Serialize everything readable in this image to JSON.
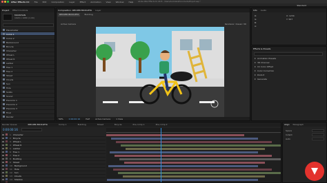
{
  "window": {
    "app_title": "After Effects CC",
    "title": "Adobe After Effects CC 2015 - /Users/Animated/Documents/Project.aep *",
    "close_color": "#ff5f57",
    "minimize_color": "#febc2e",
    "zoom_color": "#28c840"
  },
  "menu": [
    "After Effects CC",
    "File",
    "Edit",
    "Composition",
    "Layer",
    "Effect",
    "Animation",
    "View",
    "Window",
    "Help"
  ],
  "toolbar": {
    "workspace": "Standard"
  },
  "project_panel": {
    "tab": "Project",
    "tab2": "Effect Controls",
    "comp_name": "MOUNTAIN",
    "comp_info": "1920 x 1080 (1.00)",
    "items": [
      "Placeholder",
      "Comp 1",
      "Comp 2",
      "Background",
      "Bicycle",
      "Character",
      "Wheel L",
      "Wheel R",
      "Ladder",
      "Tree 1",
      "Tree 2",
      "Street",
      "Clouds",
      "Sun",
      "Hole",
      "Solids",
      "Sound",
      "Precomp 1",
      "Precomp 2",
      "Precomp 3",
      "Final",
      "Render"
    ],
    "selected_index": 1
  },
  "viewer": {
    "tab1": "Composition: RECUER BICICLETA",
    "tab2": "Layer",
    "breadcrumb_1": "RECUER BICICLETA",
    "breadcrumb_2": "Building",
    "view_label": "Active Camera",
    "renderer": "Renderer: Classic 3D",
    "zoom": "50%",
    "timecode": "0:00:00:16",
    "resolution": "Half",
    "camera": "Active Camera",
    "view_count": "1 View"
  },
  "scene": {
    "sky_color": "#7fc8e6",
    "building_color": "#dedede",
    "tree_color": "#3aa14c",
    "road_color": "#3b3b3b",
    "bike_color": "#f2c318",
    "shirt_color": "#2d9a63"
  },
  "right_panel": {
    "tab": "Info",
    "tab2": "Audio",
    "readouts": [
      "R:",
      "G:",
      "B:",
      "A:"
    ],
    "positions": [
      "X: 1234",
      "Y: 567"
    ],
    "effects_tab": "Effects & Presets",
    "effects": [
      "Animation Presets",
      "3D Channel",
      "CC Color Offset",
      "Color Correction",
      "Distort",
      "Generate"
    ],
    "preview_tab": "Preview",
    "paragraph_tab": "Paragraph"
  },
  "timeline": {
    "timecode": "0:00:00:16",
    "tabs": [
      "Render Queue",
      "RECUER BICICLETA",
      "Comp 1",
      "Building",
      "Street",
      "Bicycle",
      "Pre-comp 1",
      "Pre-comp 2"
    ],
    "layers": [
      "Character",
      "Bicycle",
      "Wheel L",
      "Wheel R",
      "Ladder",
      "Tree 1",
      "Tree 2",
      "Building",
      "Street",
      "Background",
      "Hole",
      "Sun",
      "Clouds",
      "Shadow",
      "Sky"
    ],
    "bar_colors": [
      "#8a4f58",
      "#4c5a7e",
      "#6a3f47",
      "#5a6c4a",
      "#6e6a4a",
      "#4c5a7e",
      "#8a4f58",
      "#5c5c5c"
    ]
  },
  "bottom_right": {
    "tab1": "Align",
    "tab2": "Paragraph",
    "fields": [
      "Space",
      "Indent",
      "Auto"
    ]
  },
  "brand": {
    "logo_color": "#e3322d"
  }
}
